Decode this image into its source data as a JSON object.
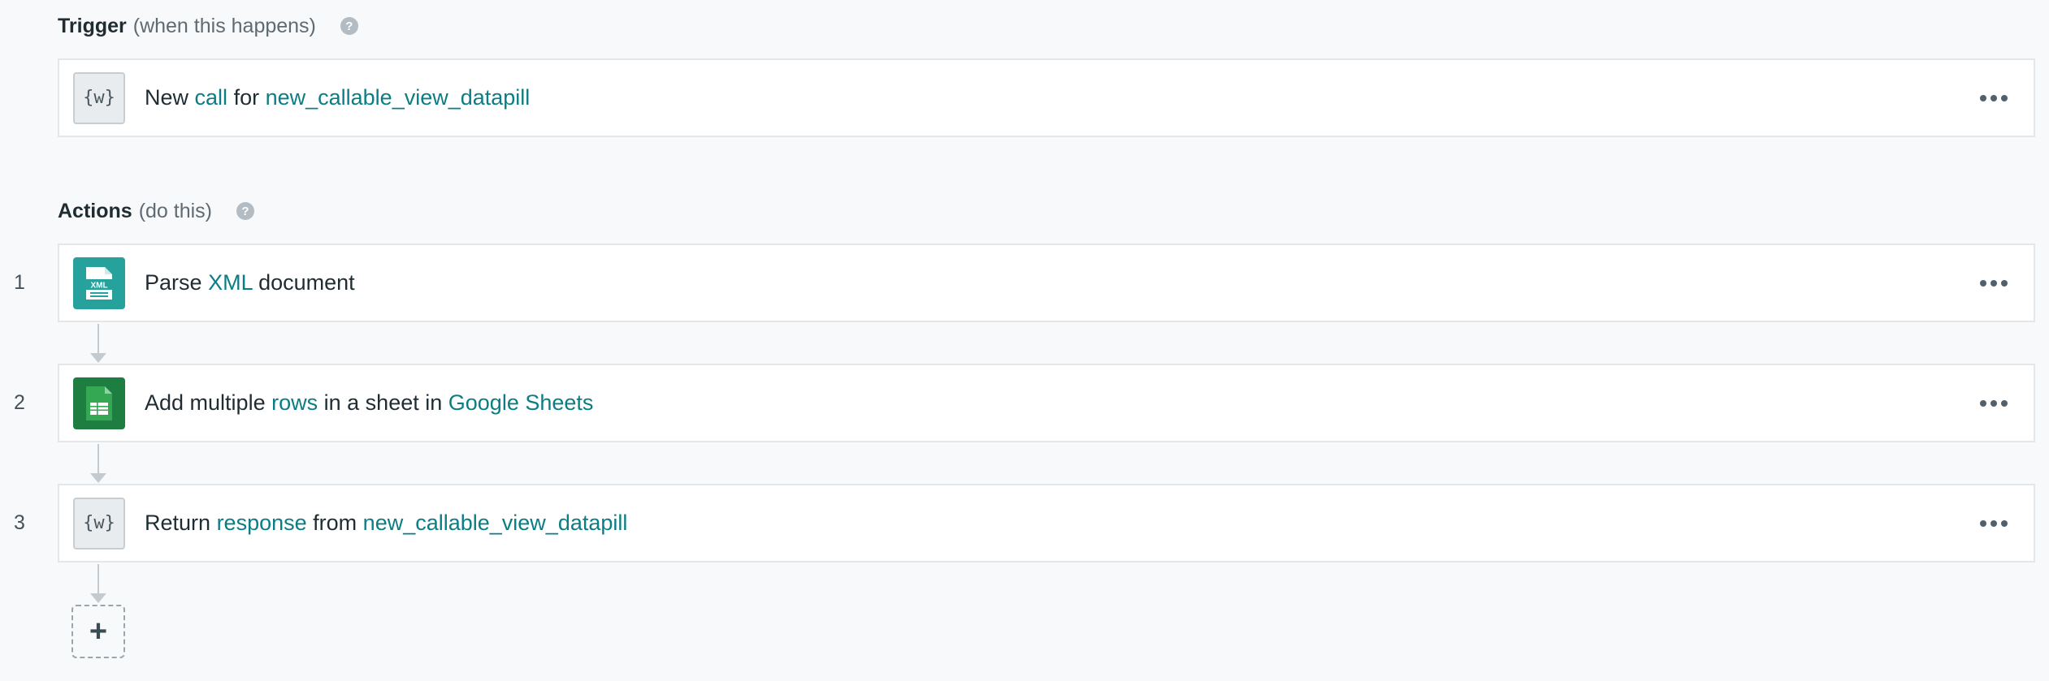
{
  "trigger": {
    "title": "Trigger",
    "subtitle": "(when this happens)",
    "help_icon": "?",
    "step": {
      "icon_text": "{w}",
      "icon_name": "workato-icon",
      "parts": [
        "New",
        "call",
        "for",
        "new_callable_view_datapill"
      ]
    }
  },
  "actions": {
    "title": "Actions",
    "subtitle": "(do this)",
    "help_icon": "?",
    "steps": [
      {
        "number": "1",
        "icon_name": "xml-document-icon",
        "icon_label": "XML",
        "parts": [
          "Parse",
          "XML",
          "document"
        ]
      },
      {
        "number": "2",
        "icon_name": "google-sheets-icon",
        "parts": [
          "Add multiple",
          "rows",
          "in a sheet in",
          "Google Sheets"
        ]
      },
      {
        "number": "3",
        "icon_text": "{w}",
        "icon_name": "workato-icon",
        "parts": [
          "Return",
          "response",
          "from",
          "new_callable_view_datapill"
        ]
      }
    ]
  },
  "add_step": {
    "icon_text": "+"
  },
  "colors": {
    "highlight": "#0b7d84",
    "xml_icon_bg": "#26a19b",
    "sheets_icon_bg": "#1e7d41",
    "card_border": "#e3e7ea",
    "page_bg": "#f8f9fa"
  }
}
